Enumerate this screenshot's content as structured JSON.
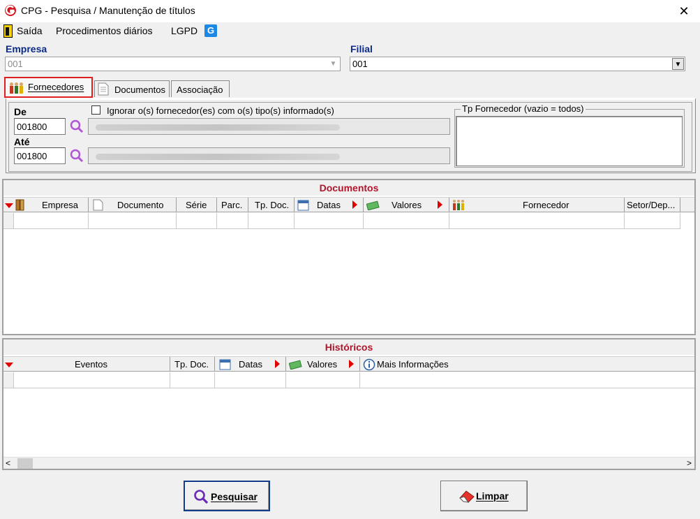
{
  "window": {
    "title": "CPG - Pesquisa / Manutenção de títulos",
    "close_glyph": "✕"
  },
  "menu": {
    "items": [
      "Saída",
      "Procedimentos diários",
      "LGPD"
    ],
    "lgpd_icon_letter": "G"
  },
  "empresa": {
    "label": "Empresa",
    "value": "001"
  },
  "filial": {
    "label": "Filial",
    "value": "001"
  },
  "tabs": [
    {
      "label": "Fornecedores",
      "active": true
    },
    {
      "label": "Documentos",
      "active": false
    },
    {
      "label": "Associação",
      "active": false
    }
  ],
  "fornecedores": {
    "de_label": "De",
    "de_value": "001800",
    "ate_label": "Até",
    "ate_value": "001800",
    "ignore_checkbox_label": "Ignorar o(s) fornecedor(es) com o(s) tipo(s) informado(s)",
    "ignore_checked": false,
    "tp_group_label": "Tp Fornecedor (vazio = todos)"
  },
  "documentos_grid": {
    "title": "Documentos",
    "columns": [
      "Empresa",
      "Documento",
      "Série",
      "Parc.",
      "Tp. Doc.",
      "Datas",
      "Valores",
      "Fornecedor",
      "Setor/Dep..."
    ]
  },
  "historicos_grid": {
    "title": "Históricos",
    "columns": [
      "Eventos",
      "Tp. Doc.",
      "Datas",
      "Valores",
      "Mais Informações"
    ]
  },
  "buttons": {
    "search": "Pesquisar",
    "clear": "Limpar"
  },
  "colors": {
    "section_title": "#b0152b",
    "label_blue": "#0b2a8a",
    "highlight": "#e02020",
    "sort_arrow": "#e00000"
  }
}
